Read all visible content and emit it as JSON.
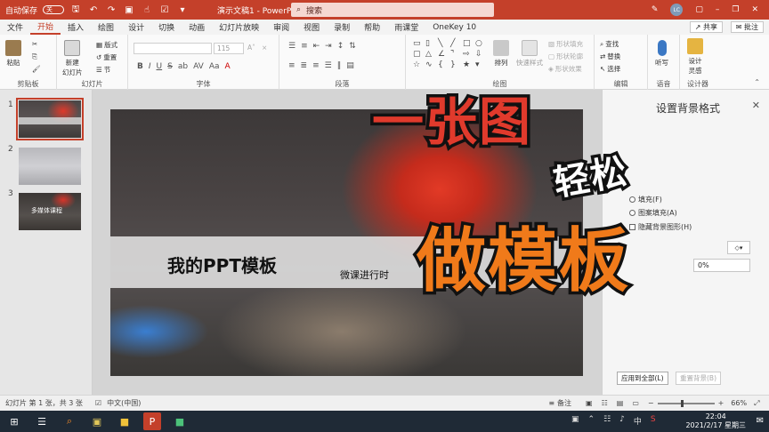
{
  "titlebar": {
    "autosave_label": "自动保存",
    "autosave_state": "关",
    "document_title": "演示文稿1 - PowerPoint",
    "search_placeholder": "搜索",
    "user_initials": "LC",
    "accent_color": "#c4402a"
  },
  "menu": {
    "tabs": [
      "文件",
      "开始",
      "插入",
      "绘图",
      "设计",
      "切换",
      "动画",
      "幻灯片放映",
      "审阅",
      "视图",
      "录制",
      "帮助",
      "雨课堂",
      "OneKey 10"
    ],
    "active_tab": "开始",
    "share_label": "共享",
    "comment_label": "批注"
  },
  "ribbon": {
    "clipboard": {
      "paste": "粘贴",
      "group": "剪贴板"
    },
    "slides": {
      "new_slide_line1": "新建",
      "new_slide_line2": "幻灯片",
      "layout": "版式",
      "reset": "重置",
      "section": "节",
      "group": "幻灯片"
    },
    "font": {
      "size_placeholder": "115",
      "group": "字体",
      "styles": [
        "B",
        "I",
        "U",
        "S",
        "ab",
        "AV",
        "Aa"
      ]
    },
    "paragraph": {
      "group": "段落"
    },
    "drawing": {
      "arrange": "排列",
      "quick_styles": "快速样式",
      "shape_fill": "形状填充",
      "shape_outline": "形状轮廓",
      "shape_effects": "形状效果",
      "group": "绘图"
    },
    "editing": {
      "find": "查找",
      "replace": "替换",
      "select": "选择",
      "group": "编辑"
    },
    "voice": {
      "dictate": "听写",
      "group": "语音"
    },
    "designer": {
      "ideas_line1": "设计",
      "ideas_line2": "灵感",
      "group": "设计器"
    }
  },
  "thumbnails": [
    {
      "number": "1",
      "selected": true
    },
    {
      "number": "2",
      "selected": false
    },
    {
      "number": "3",
      "selected": false,
      "caption": "多媒体课程"
    }
  ],
  "slide": {
    "title": "我的PPT模板",
    "subtitle": "微课进行时"
  },
  "format_pane": {
    "title": "设置背景格式",
    "options": [
      "填充(F)",
      "图案填充(A)",
      "隐藏背景图形(H)"
    ],
    "transparency_value": "0%",
    "apply_all": "应用到全部(L)",
    "reset_background": "重置背景(B)"
  },
  "overlay": {
    "line1": "一张图",
    "line2": "轻松",
    "line3": "做模板"
  },
  "statusbar": {
    "slide_info": "幻灯片 第 1 张，共 3 张",
    "language": "中文(中国)",
    "notes": "备注",
    "zoom": "66%"
  },
  "taskbar": {
    "ime": "中",
    "time": "22:04",
    "date": "2021/2/17 星期三"
  }
}
